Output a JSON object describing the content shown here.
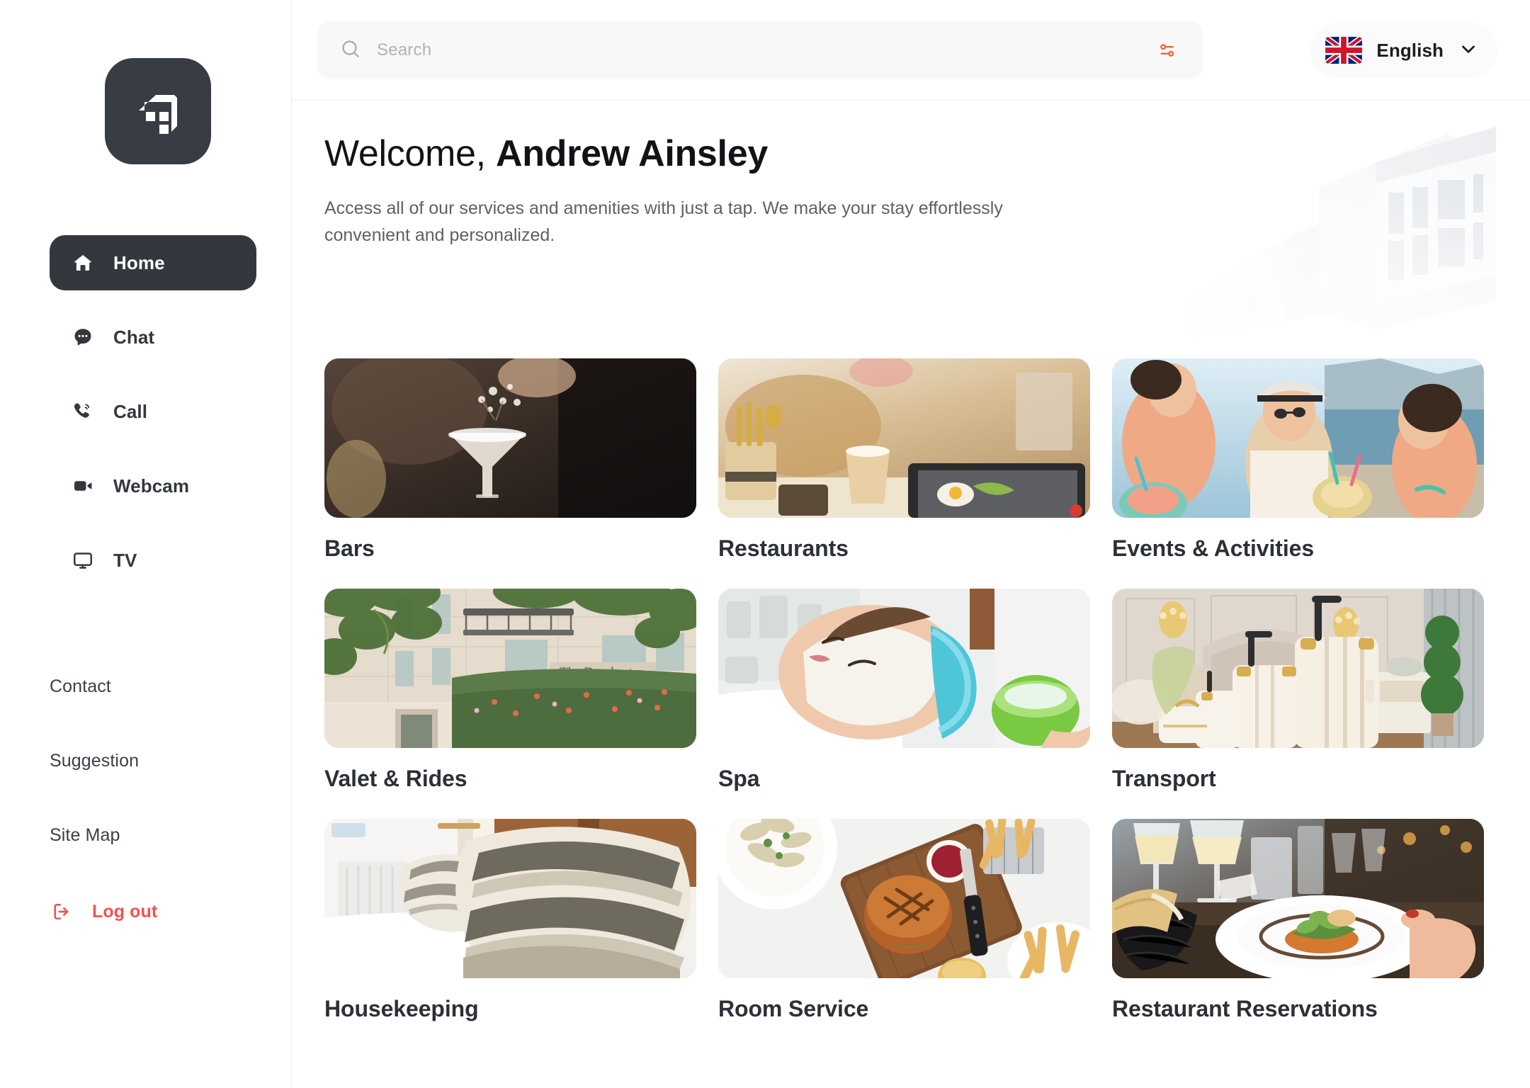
{
  "brand": {
    "logo_icon": "hotel-building-logo"
  },
  "search": {
    "placeholder": "Search",
    "search_icon": "search-icon",
    "filter_icon": "filter-sliders-icon"
  },
  "language": {
    "selected": "English",
    "flag": "uk-flag-icon",
    "chevron_icon": "chevron-down-icon"
  },
  "hero": {
    "greeting": "Welcome, ",
    "user_name": "Andrew Ainsley",
    "subtitle": "Access all of our services and amenities with just a tap. We make your stay effortlessly convenient and personalized."
  },
  "sidebar": {
    "nav": [
      {
        "label": "Home",
        "icon": "home-icon",
        "active": true
      },
      {
        "label": "Chat",
        "icon": "chat-bubble-icon",
        "active": false
      },
      {
        "label": "Call",
        "icon": "phone-call-icon",
        "active": false
      },
      {
        "label": "Webcam",
        "icon": "video-camera-icon",
        "active": false
      },
      {
        "label": "TV",
        "icon": "tv-monitor-icon",
        "active": false
      }
    ],
    "links": [
      {
        "label": "Contact"
      },
      {
        "label": "Suggestion"
      },
      {
        "label": "Site Map"
      }
    ],
    "logout": {
      "label": "Log out",
      "icon": "logout-icon"
    }
  },
  "services": [
    {
      "title": "Bars",
      "image": "cocktail-coupe-bar"
    },
    {
      "title": "Restaurants",
      "image": "cafe-table-latte-tablet"
    },
    {
      "title": "Events & Activities",
      "image": "friends-beach-drinks"
    },
    {
      "title": "Valet & Rides",
      "image": "dorchester-hotel-facade"
    },
    {
      "title": "Spa",
      "image": "facial-mask-treatment"
    },
    {
      "title": "Transport",
      "image": "cream-luggage-set-bedroom"
    },
    {
      "title": "Housekeeping",
      "image": "striped-pillows-bed"
    },
    {
      "title": "Room Service",
      "image": "burger-fries-board"
    },
    {
      "title": "Restaurant Reservations",
      "image": "fine-dining-plate-served"
    }
  ],
  "colors": {
    "accent": "#f4524d",
    "dark": "#33383f",
    "text": "#2c3037",
    "muted": "#5d6166"
  }
}
